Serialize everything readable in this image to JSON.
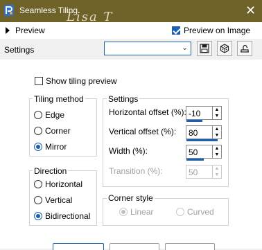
{
  "window": {
    "title": "Seamless Tiling",
    "close_glyph": "✕",
    "watermark": "Lisa T"
  },
  "toolbar": {
    "preview_label": "Preview",
    "preview_on_image_label": "Preview on Image",
    "preview_on_image_checked": true
  },
  "settings_row": {
    "label": "Settings",
    "preset_value": "",
    "icons": [
      "save-icon",
      "reset-icon",
      "randomize-icon"
    ]
  },
  "main": {
    "show_tiling_preview": {
      "label": "Show tiling preview",
      "checked": false
    },
    "tiling_method": {
      "title": "Tiling method",
      "options": [
        {
          "label": "Edge",
          "selected": false
        },
        {
          "label": "Corner",
          "selected": false
        },
        {
          "label": "Mirror",
          "selected": true
        }
      ]
    },
    "direction": {
      "title": "Direction",
      "options": [
        {
          "label": "Horizontal",
          "selected": false
        },
        {
          "label": "Vertical",
          "selected": false
        },
        {
          "label": "Bidirectional",
          "selected": true
        }
      ]
    },
    "settings": {
      "title": "Settings",
      "fields": [
        {
          "label": "Horizontal offset (%):",
          "value": "-10",
          "level": 0.45,
          "enabled": true
        },
        {
          "label": "Vertical offset (%):",
          "value": "80",
          "level": 0.9,
          "enabled": true
        },
        {
          "label": "Width (%):",
          "value": "50",
          "level": 0.5,
          "enabled": true
        },
        {
          "label": "Transition (%):",
          "value": "50",
          "level": 0.5,
          "enabled": false
        }
      ]
    },
    "corner_style": {
      "title": "Corner style",
      "options": [
        {
          "label": "Linear",
          "selected": true,
          "enabled": false
        },
        {
          "label": "Curved",
          "selected": false,
          "enabled": false
        }
      ]
    }
  }
}
